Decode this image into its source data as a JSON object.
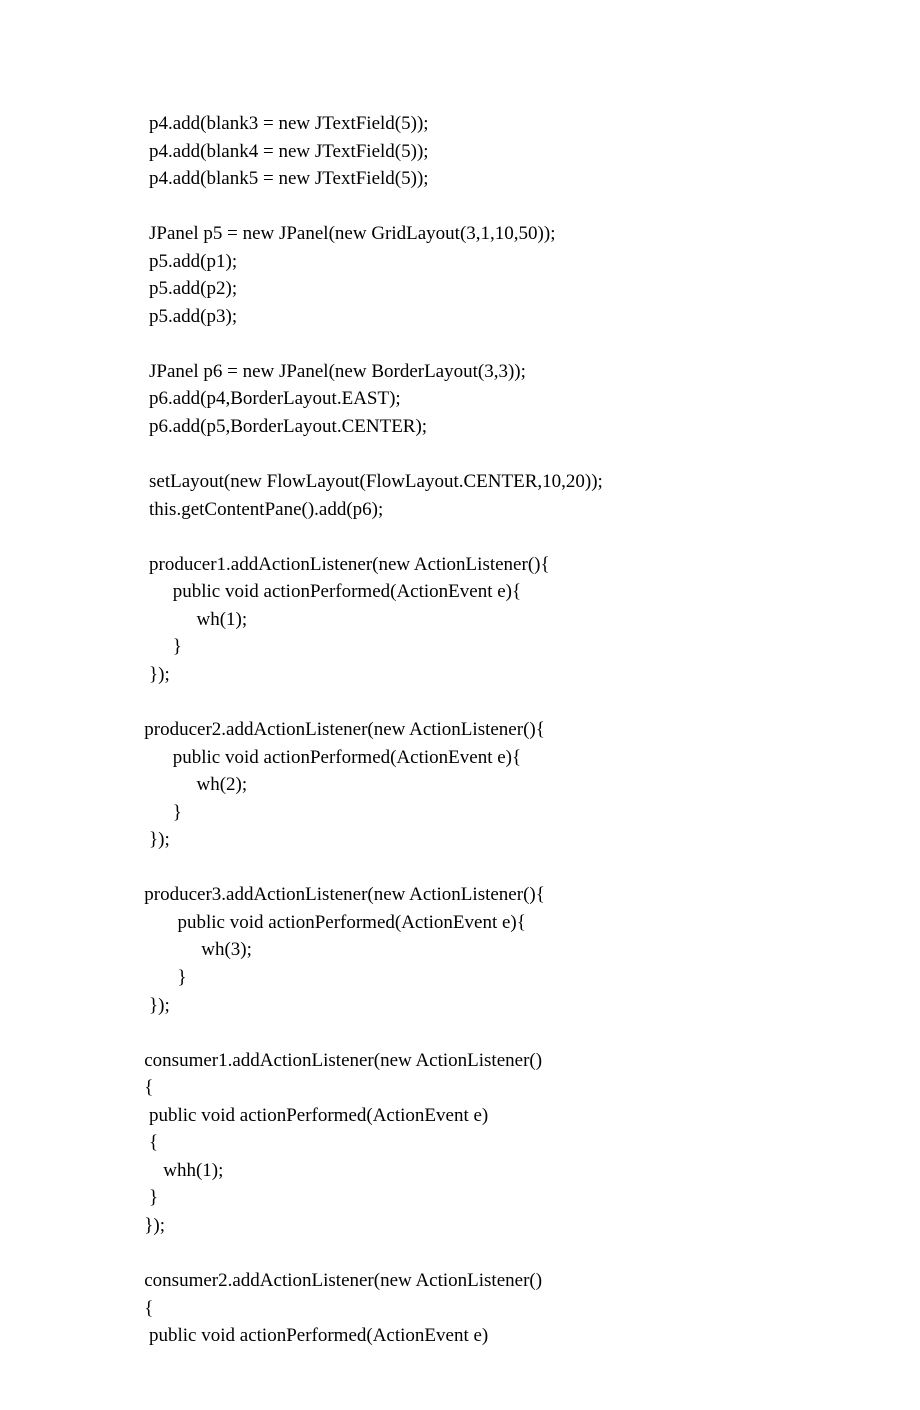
{
  "code": {
    "lines": [
      "    p4.add(blank3 = new JTextField(5));",
      "    p4.add(blank4 = new JTextField(5));",
      "    p4.add(blank5 = new JTextField(5));",
      "",
      "    JPanel p5 = new JPanel(new GridLayout(3,1,10,50));",
      "    p5.add(p1);",
      "    p5.add(p2);",
      "    p5.add(p3);",
      "",
      "    JPanel p6 = new JPanel(new BorderLayout(3,3));",
      "    p6.add(p4,BorderLayout.EAST);",
      "    p6.add(p5,BorderLayout.CENTER);",
      "",
      "    setLayout(new FlowLayout(FlowLayout.CENTER,10,20));",
      "    this.getContentPane().add(p6);",
      "",
      "    producer1.addActionListener(new ActionListener(){",
      "         public void actionPerformed(ActionEvent e){",
      "              wh(1);",
      "         }",
      "    });",
      "",
      "   producer2.addActionListener(new ActionListener(){",
      "         public void actionPerformed(ActionEvent e){",
      "              wh(2);",
      "         }",
      "    });",
      "",
      "   producer3.addActionListener(new ActionListener(){",
      "          public void actionPerformed(ActionEvent e){",
      "               wh(3);",
      "          }",
      "    });",
      "",
      "   consumer1.addActionListener(new ActionListener()",
      "   {",
      "    public void actionPerformed(ActionEvent e)",
      "    {",
      "       whh(1);",
      "    }",
      "   });",
      "",
      "   consumer2.addActionListener(new ActionListener()",
      "   {",
      "    public void actionPerformed(ActionEvent e)"
    ]
  }
}
